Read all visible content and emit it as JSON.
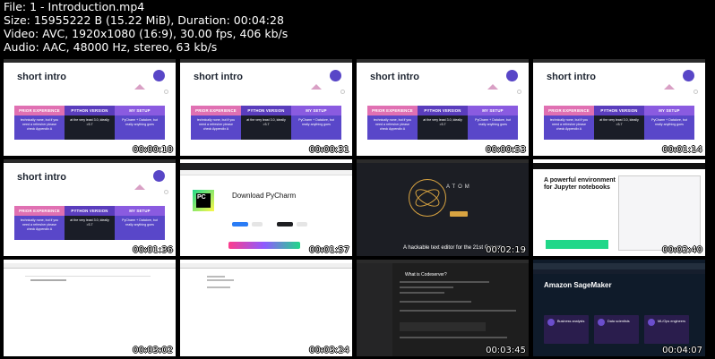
{
  "file_info": {
    "file": "File: 1 - Introduction.mp4",
    "size": "Size: 15955222 B (15.22 MiB), Duration: 00:04:28",
    "video": "Video: AVC, 1920x1080 (16:9), 30.00 fps, 406 kb/s",
    "audio": "Audio: AAC, 48000 Hz, stereo, 63 kb/s"
  },
  "slide": {
    "title": "short intro",
    "col1_head": "PRIOR EXPERIENCE",
    "col1_body": "technically none, but if you need a refresher please check Appendix A",
    "col2_head": "PYTHON VERSION",
    "col2_body": "at the very least 3.0, ideally >3.7",
    "col3_head": "MY SETUP",
    "col3_body": "PyCharm + Datalore, but really anything goes"
  },
  "thumbs": [
    {
      "time": "00:00:10"
    },
    {
      "time": "00:00:31"
    },
    {
      "time": "00:00:53"
    },
    {
      "time": "00:01:14"
    },
    {
      "time": "00:01:36"
    },
    {
      "time": "00:01:57",
      "heading": "Download PyCharm",
      "logo": "PC"
    },
    {
      "time": "00:02:19",
      "wordmark": "ATOM",
      "tagline": "A hackable text editor for the 21st Century"
    },
    {
      "time": "00:02:40",
      "heading": "A powerful environment for Jupyter notebooks"
    },
    {
      "time": "00:03:02"
    },
    {
      "time": "00:03:24"
    },
    {
      "time": "00:03:45",
      "heading": "What is Codeserver?"
    },
    {
      "time": "00:04:07",
      "heading": "Amazon SageMaker",
      "cards": [
        {
          "title": "Business analysts"
        },
        {
          "title": "Data scientists"
        },
        {
          "title": "ML/Ops engineers"
        }
      ]
    }
  ]
}
